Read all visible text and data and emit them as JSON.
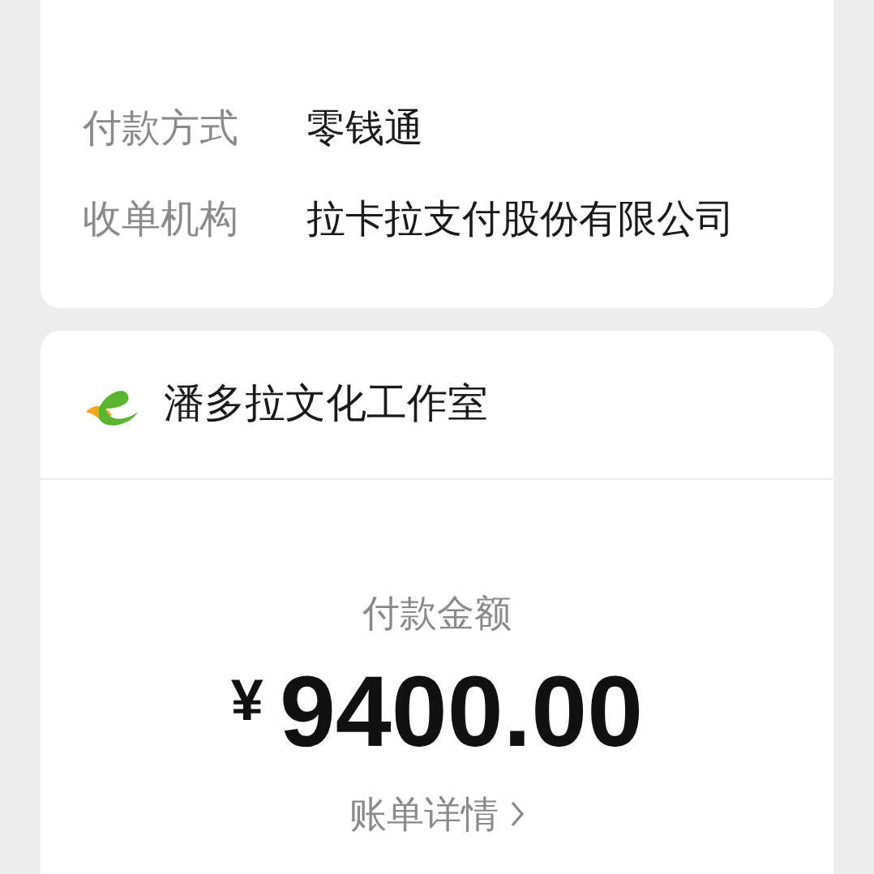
{
  "payment_info": [
    {
      "label": "付款方式",
      "value": "零钱通"
    },
    {
      "label": "收单机构",
      "value": "拉卡拉支付股份有限公司"
    }
  ],
  "merchant": {
    "name": "潘多拉文化工作室"
  },
  "amount_label": "付款金额",
  "currency": "¥",
  "amount": "9400.00",
  "bill_details_link": "账单详情"
}
